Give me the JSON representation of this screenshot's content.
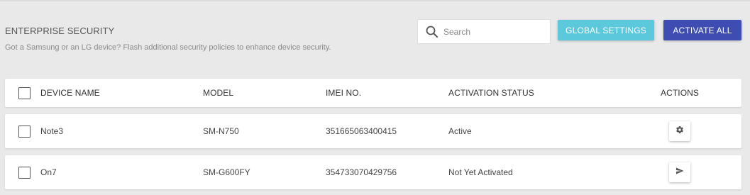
{
  "header": {
    "title": "ENTERPRISE SECURITY",
    "subtitle": "Got a Samsung or an LG device? Flash additional security policies to enhance device security."
  },
  "search": {
    "placeholder": "Search",
    "value": "",
    "icon": "search-icon"
  },
  "toolbar": {
    "global_settings_label": "GLOBAL SETTINGS",
    "activate_all_label": "ACTIVATE ALL"
  },
  "colors": {
    "global_settings_button": "#5bc8dc",
    "activate_all_button": "#3f4db3",
    "background": "#e9e9e9"
  },
  "table": {
    "columns": [
      "DEVICE NAME",
      "MODEL",
      "IMEI NO.",
      "ACTIVATION STATUS",
      "ACTIONS"
    ],
    "rows": [
      {
        "device_name": "Note3",
        "model": "SM-N750",
        "imei": "351665063400415",
        "status": "Active",
        "action_icon": "gear-icon"
      },
      {
        "device_name": "On7",
        "model": "SM-G600FY",
        "imei": "354733070429756",
        "status": "Not Yet Activated",
        "action_icon": "send-icon"
      }
    ]
  }
}
